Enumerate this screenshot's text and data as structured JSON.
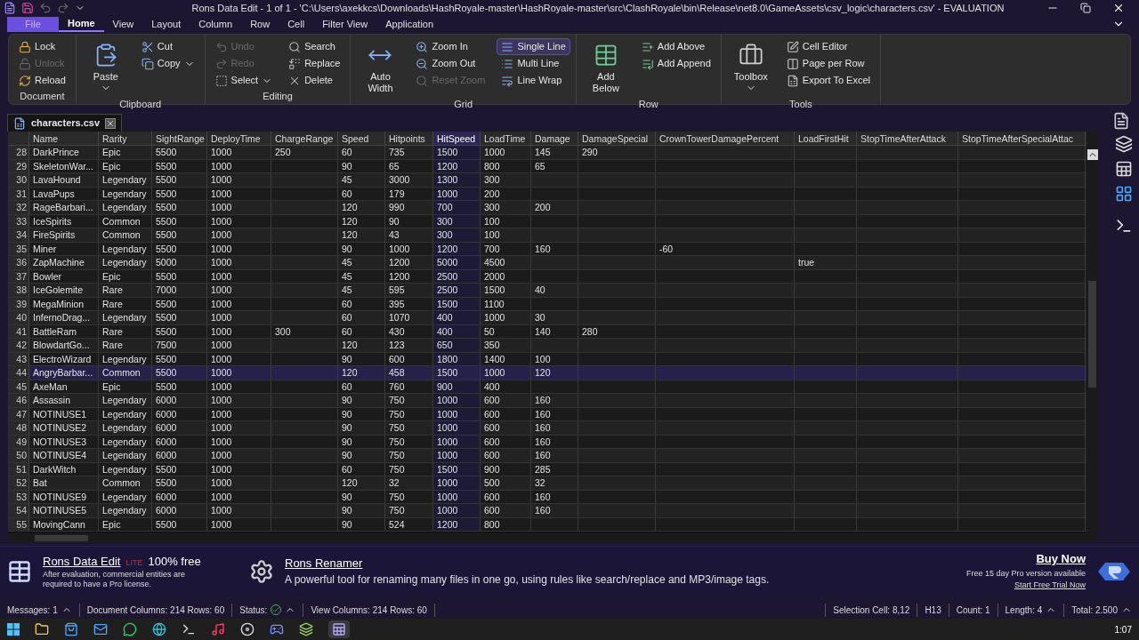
{
  "window": {
    "title": "Rons Data Edit - 1 of 1 - 'C:\\Users\\axekkcs\\Downloads\\HashRoyale-master\\HashRoyale-master\\src\\ClashRoyale\\bin\\Release\\net8.0\\GameAssets\\csv_logic\\characters.csv' - EVALUATION"
  },
  "menu": [
    {
      "label": "File",
      "selected": false,
      "kind": "file"
    },
    {
      "label": "Home",
      "selected": true,
      "kind": "tab"
    },
    {
      "label": "View",
      "selected": false,
      "kind": "tab"
    },
    {
      "label": "Layout",
      "selected": false,
      "kind": "tab"
    },
    {
      "label": "Column",
      "selected": false,
      "kind": "tab"
    },
    {
      "label": "Row",
      "selected": false,
      "kind": "tab"
    },
    {
      "label": "Cell",
      "selected": false,
      "kind": "tab"
    },
    {
      "label": "Filter View",
      "selected": false,
      "kind": "tab"
    },
    {
      "label": "Application",
      "selected": false,
      "kind": "tab"
    }
  ],
  "ribbon": [
    {
      "label": "Document",
      "items": [
        {
          "label": "Lock",
          "kind": "small",
          "disabled": false,
          "selected": false,
          "dropdown": false
        },
        {
          "label": "Unlock",
          "kind": "small",
          "disabled": true,
          "selected": false,
          "dropdown": false
        },
        {
          "label": "Reload",
          "kind": "small",
          "disabled": false,
          "selected": false,
          "dropdown": false
        }
      ]
    },
    {
      "label": "Clipboard",
      "items": [
        {
          "label": "Paste",
          "kind": "large",
          "disabled": false,
          "selected": false,
          "dropdown": true
        },
        {
          "label": "Cut",
          "kind": "small",
          "disabled": false,
          "selected": false,
          "dropdown": false
        },
        {
          "label": "Copy",
          "kind": "small",
          "disabled": false,
          "selected": false,
          "dropdown": true
        }
      ]
    },
    {
      "label": "Editing",
      "items": [
        {
          "label": "Undo",
          "kind": "small",
          "disabled": true,
          "selected": false,
          "dropdown": false
        },
        {
          "label": "Redo",
          "kind": "small",
          "disabled": true,
          "selected": false,
          "dropdown": false
        },
        {
          "label": "Select",
          "kind": "small",
          "disabled": false,
          "selected": false,
          "dropdown": true
        },
        {
          "label": "Search",
          "kind": "small",
          "disabled": false,
          "selected": false,
          "dropdown": false
        },
        {
          "label": "Replace",
          "kind": "small",
          "disabled": false,
          "selected": false,
          "dropdown": false
        },
        {
          "label": "Delete",
          "kind": "small",
          "disabled": false,
          "selected": false,
          "dropdown": false
        }
      ]
    },
    {
      "label": "Grid",
      "items": [
        {
          "label": "Auto Width",
          "kind": "large",
          "disabled": false,
          "selected": false,
          "dropdown": false
        },
        {
          "label": "Zoom In",
          "kind": "small",
          "disabled": false,
          "selected": false,
          "dropdown": false
        },
        {
          "label": "Zoom Out",
          "kind": "small",
          "disabled": false,
          "selected": false,
          "dropdown": false
        },
        {
          "label": "Reset Zoom",
          "kind": "small",
          "disabled": true,
          "selected": false,
          "dropdown": false
        },
        {
          "label": "Single Line",
          "kind": "small",
          "disabled": false,
          "selected": true,
          "dropdown": false
        },
        {
          "label": "Multi Line",
          "kind": "small",
          "disabled": false,
          "selected": false,
          "dropdown": false
        },
        {
          "label": "Line Wrap",
          "kind": "small",
          "disabled": false,
          "selected": false,
          "dropdown": false
        }
      ]
    },
    {
      "label": "Row",
      "items": [
        {
          "label": "Add Below",
          "kind": "large",
          "disabled": false,
          "selected": false,
          "dropdown": false
        },
        {
          "label": "Add Above",
          "kind": "small",
          "disabled": false,
          "selected": false,
          "dropdown": false
        },
        {
          "label": "Add Append",
          "kind": "small",
          "disabled": false,
          "selected": false,
          "dropdown": false
        }
      ]
    },
    {
      "label": "Tools",
      "items": [
        {
          "label": "Toolbox",
          "kind": "large",
          "disabled": false,
          "selected": false,
          "dropdown": true
        },
        {
          "label": "Cell Editor",
          "kind": "small",
          "disabled": false,
          "selected": false,
          "dropdown": false
        },
        {
          "label": "Page per Row",
          "kind": "small",
          "disabled": false,
          "selected": false,
          "dropdown": false
        },
        {
          "label": "Export To Excel",
          "kind": "small",
          "disabled": false,
          "selected": false,
          "dropdown": false
        }
      ]
    }
  ],
  "document_tab": {
    "label": "characters.csv"
  },
  "table": {
    "columns": [
      {
        "label": "Name",
        "selected": false
      },
      {
        "label": "Rarity",
        "selected": false
      },
      {
        "label": "SightRange",
        "selected": false
      },
      {
        "label": "DeployTime",
        "selected": false
      },
      {
        "label": "ChargeRange",
        "selected": false
      },
      {
        "label": "Speed",
        "selected": false
      },
      {
        "label": "Hitpoints",
        "selected": false
      },
      {
        "label": "HitSpeed",
        "selected": true
      },
      {
        "label": "LoadTime",
        "selected": false
      },
      {
        "label": "Damage",
        "selected": false
      },
      {
        "label": "DamageSpecial",
        "selected": false
      },
      {
        "label": "CrownTowerDamagePercent",
        "selected": false
      },
      {
        "label": "LoadFirstHit",
        "selected": false
      },
      {
        "label": "StopTimeAfterAttack",
        "selected": false
      },
      {
        "label": "StopTimeAfterSpecialAttac",
        "selected": false
      }
    ],
    "rows": [
      {
        "num": "28",
        "selected": false,
        "cells": [
          "DarkPrince",
          "Epic",
          "5500",
          "1000",
          "250",
          "60",
          "735",
          "1500",
          "1000",
          "145",
          "290"
        ]
      },
      {
        "num": "29",
        "selected": false,
        "cells": [
          "SkeletonWar...",
          "Epic",
          "5500",
          "1000",
          null,
          "90",
          "65",
          "1200",
          "800",
          "65"
        ]
      },
      {
        "num": "30",
        "selected": false,
        "cells": [
          "LavaHound",
          "Legendary",
          "5500",
          "1000",
          null,
          "45",
          "3000",
          "1300",
          "300"
        ]
      },
      {
        "num": "31",
        "selected": false,
        "cells": [
          "LavaPups",
          "Legendary",
          "5500",
          "1000",
          null,
          "60",
          "179",
          "1000",
          "200"
        ]
      },
      {
        "num": "32",
        "selected": false,
        "cells": [
          "RageBarbari...",
          "Legendary",
          "5500",
          "1000",
          null,
          "120",
          "990",
          "700",
          "300",
          "200"
        ]
      },
      {
        "num": "33",
        "selected": false,
        "cells": [
          "IceSpirits",
          "Common",
          "5500",
          "1000",
          null,
          "120",
          "90",
          "300",
          "100"
        ]
      },
      {
        "num": "34",
        "selected": false,
        "cells": [
          "FireSpirits",
          "Common",
          "5500",
          "1000",
          null,
          "120",
          "43",
          "300",
          "100"
        ]
      },
      {
        "num": "35",
        "selected": false,
        "cells": [
          "Miner",
          "Legendary",
          "5500",
          "1000",
          null,
          "90",
          "1000",
          "1200",
          "700",
          "160",
          null,
          "-60"
        ]
      },
      {
        "num": "36",
        "selected": false,
        "cells": [
          "ZapMachine",
          "Legendary",
          "5000",
          "1000",
          null,
          "45",
          "1200",
          "5000",
          "4500",
          null,
          null,
          null,
          "true"
        ]
      },
      {
        "num": "37",
        "selected": false,
        "cells": [
          "Bowler",
          "Epic",
          "5500",
          "1000",
          null,
          "45",
          "1200",
          "2500",
          "2000"
        ]
      },
      {
        "num": "38",
        "selected": false,
        "cells": [
          "IceGolemite",
          "Rare",
          "7000",
          "1000",
          null,
          "45",
          "595",
          "2500",
          "1500",
          "40"
        ]
      },
      {
        "num": "39",
        "selected": false,
        "cells": [
          "MegaMinion",
          "Rare",
          "5500",
          "1000",
          null,
          "60",
          "395",
          "1500",
          "1100"
        ]
      },
      {
        "num": "40",
        "selected": false,
        "cells": [
          "InfernoDrag...",
          "Legendary",
          "5500",
          "1000",
          null,
          "60",
          "1070",
          "400",
          "1000",
          "30"
        ]
      },
      {
        "num": "41",
        "selected": false,
        "cells": [
          "BattleRam",
          "Rare",
          "5500",
          "1000",
          "300",
          "60",
          "430",
          "400",
          "50",
          "140",
          "280"
        ]
      },
      {
        "num": "42",
        "selected": false,
        "cells": [
          "BlowdartGo...",
          "Rare",
          "7500",
          "1000",
          null,
          "120",
          "123",
          "650",
          "350"
        ]
      },
      {
        "num": "43",
        "selected": false,
        "cells": [
          "ElectroWizard",
          "Legendary",
          "5500",
          "1000",
          null,
          "90",
          "600",
          "1800",
          "1400",
          "100"
        ]
      },
      {
        "num": "44",
        "selected": true,
        "cells": [
          "AngryBarbar...",
          "Common",
          "5500",
          "1000",
          null,
          "120",
          "458",
          "1500",
          "1000",
          "120"
        ]
      },
      {
        "num": "45",
        "selected": false,
        "cells": [
          "AxeMan",
          "Epic",
          "5500",
          "1000",
          null,
          "60",
          "760",
          "900",
          "400"
        ]
      },
      {
        "num": "46",
        "selected": false,
        "cells": [
          "Assassin",
          "Legendary",
          "6000",
          "1000",
          null,
          "90",
          "750",
          "1000",
          "600",
          "160"
        ]
      },
      {
        "num": "47",
        "selected": false,
        "cells": [
          "NOTINUSE1",
          "Legendary",
          "6000",
          "1000",
          null,
          "90",
          "750",
          "1000",
          "600",
          "160"
        ]
      },
      {
        "num": "48",
        "selected": false,
        "cells": [
          "NOTINUSE2",
          "Legendary",
          "6000",
          "1000",
          null,
          "90",
          "750",
          "1000",
          "600",
          "160"
        ]
      },
      {
        "num": "49",
        "selected": false,
        "cells": [
          "NOTINUSE3",
          "Legendary",
          "6000",
          "1000",
          null,
          "90",
          "750",
          "1000",
          "600",
          "160"
        ]
      },
      {
        "num": "50",
        "selected": false,
        "cells": [
          "NOTINUSE4",
          "Legendary",
          "6000",
          "1000",
          null,
          "90",
          "750",
          "1000",
          "600",
          "160"
        ]
      },
      {
        "num": "51",
        "selected": false,
        "cells": [
          "DarkWitch",
          "Legendary",
          "5500",
          "1000",
          null,
          "60",
          "750",
          "1500",
          "900",
          "285"
        ]
      },
      {
        "num": "52",
        "selected": false,
        "cells": [
          "Bat",
          "Common",
          "5500",
          "1000",
          null,
          "120",
          "32",
          "1000",
          "500",
          "32"
        ]
      },
      {
        "num": "53",
        "selected": false,
        "cells": [
          "NOTINUSE9",
          "Legendary",
          "6000",
          "1000",
          null,
          "90",
          "750",
          "1000",
          "600",
          "160"
        ]
      },
      {
        "num": "54",
        "selected": false,
        "cells": [
          "NOTINUSE5",
          "Legendary",
          "6000",
          "1000",
          null,
          "90",
          "750",
          "1000",
          "600",
          "160"
        ]
      },
      {
        "num": "55",
        "selected": false,
        "cells": [
          "MovingCann",
          "Epic",
          "5500",
          "1000",
          null,
          "90",
          "524",
          "1200",
          "800"
        ]
      }
    ]
  },
  "ad": {
    "product": "Rons Data Edit",
    "edition": "LITE",
    "free": "100% free",
    "note": "After evaluation, commercial entities are required to have a Pro license.",
    "other_product": "Rons Renamer",
    "other_description": "A powerful tool for renaming many files in one go, using rules like search/replace and MP3/image tags.",
    "buy": "Buy Now",
    "trial_note": "Free 15 day Pro version available",
    "trial_link": "Start Free Trial Now"
  },
  "status_bar": {
    "left": [
      {
        "text": "Messages: 1",
        "kind": "caret"
      },
      {
        "text": "Document Columns: 214 Rows: 60",
        "kind": "plain"
      },
      {
        "text": "Status:",
        "kind": "ok"
      },
      {
        "text": "View Columns: 214 Rows: 60",
        "kind": "plain"
      }
    ],
    "right": [
      {
        "text": "Selection Cell: 8,12",
        "kind": "plain"
      },
      {
        "text": "H13",
        "kind": "plain"
      },
      {
        "text": "Count: 1",
        "kind": "plain"
      },
      {
        "text": "Length: 4",
        "kind": "caret"
      },
      {
        "text": "Total: 2.500",
        "kind": "caret"
      }
    ]
  },
  "taskbar": {
    "clock": "1:07"
  }
}
